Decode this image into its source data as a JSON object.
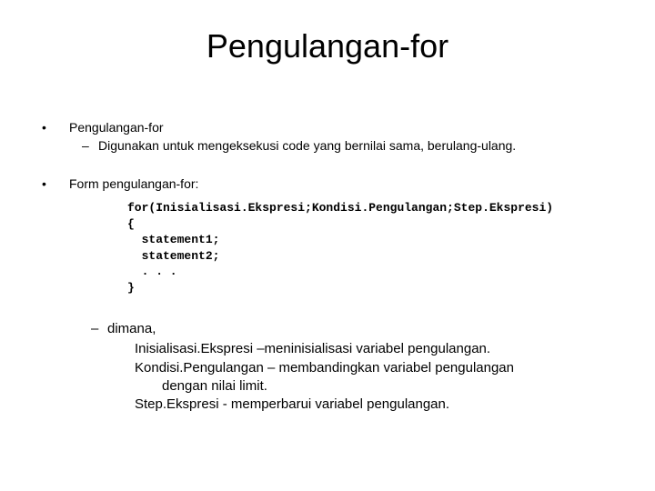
{
  "title": "Pengulangan-for",
  "bullet1": {
    "heading": "Pengulangan-for",
    "sub": "Digunakan untuk mengeksekusi code yang bernilai sama, berulang-ulang."
  },
  "bullet2": {
    "heading": "Form pengulangan-for:"
  },
  "code": "for(Inisialisasi.Ekspresi;Kondisi.Pengulangan;Step.Ekspresi)\n{\n  statement1;\n  statement2;\n  . . .\n}",
  "explain": {
    "lead": "dimana,",
    "l1": "Inisialisasi.Ekspresi  –meninisialisasi variabel pengulangan.",
    "l2": "Kondisi.Pengulangan            – membandingkan variabel pengulangan",
    "l2b": "dengan                                               nilai limit.",
    "l3": "Step.Ekspresi               - memperbarui variabel pengulangan."
  }
}
